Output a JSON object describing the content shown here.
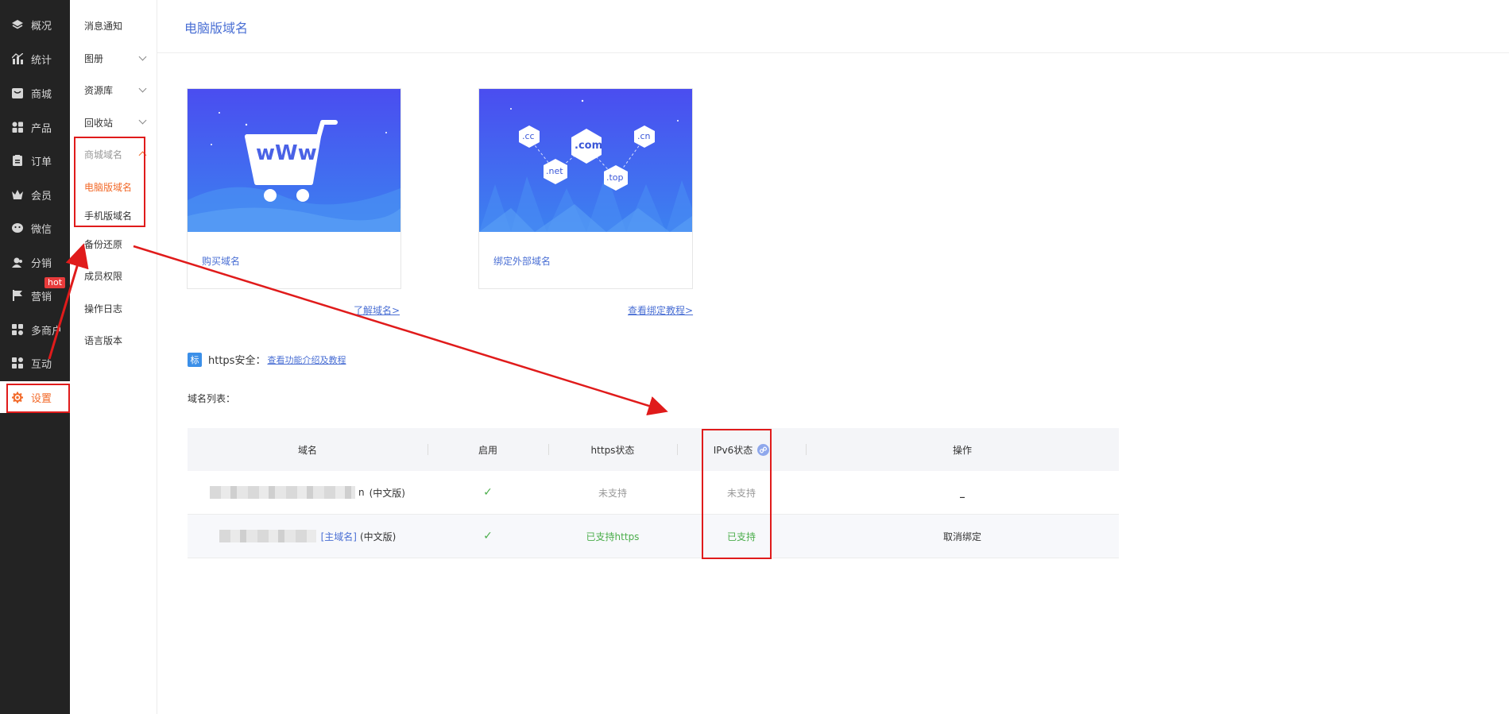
{
  "nav": {
    "items": [
      {
        "label": "概况",
        "icon": "layers-icon"
      },
      {
        "label": "统计",
        "icon": "chart-icon"
      },
      {
        "label": "商城",
        "icon": "shop-icon"
      },
      {
        "label": "产品",
        "icon": "grid-icon"
      },
      {
        "label": "订单",
        "icon": "clipboard-icon"
      },
      {
        "label": "会员",
        "icon": "crown-icon"
      },
      {
        "label": "微信",
        "icon": "wechat-icon"
      },
      {
        "label": "分销",
        "icon": "users-icon"
      },
      {
        "label": "营销",
        "icon": "flag-icon"
      },
      {
        "label": "多商户",
        "icon": "multi-shop-icon"
      },
      {
        "label": "互动",
        "icon": "interact-icon"
      },
      {
        "label": "设置",
        "icon": "gear-icon"
      }
    ],
    "hot_badge": "hot"
  },
  "submenu": {
    "items": [
      {
        "label": "消息通知"
      },
      {
        "label": "图册"
      },
      {
        "label": "资源库"
      },
      {
        "label": "回收站"
      },
      {
        "label": "商城域名"
      },
      {
        "label": "电脑版域名"
      },
      {
        "label": "手机版域名"
      },
      {
        "label": "备份还原"
      },
      {
        "label": "成员权限"
      },
      {
        "label": "操作日志"
      },
      {
        "label": "语言版本"
      }
    ]
  },
  "page": {
    "title": "电脑版域名"
  },
  "cards": [
    {
      "caption": "购买域名",
      "link": "了解域名>",
      "banner_text": "wWw"
    },
    {
      "caption": "绑定外部域名",
      "link": "查看绑定教程>",
      "bubbles": [
        ".cc",
        ".com",
        ".cn",
        ".net",
        ".top"
      ]
    }
  ],
  "https": {
    "badge": "标",
    "label": "https安全：",
    "link": "查看功能介绍及教程"
  },
  "list_label": "域名列表：",
  "table": {
    "headers": [
      "域名",
      "启用",
      "https状态",
      "IPv6状态",
      "操作"
    ],
    "rows": [
      {
        "domain_suffix": "n",
        "tag": "",
        "lang": "(中文版)",
        "enabled": "✓",
        "https": "未支持",
        "ipv6": "未支持",
        "action": "_"
      },
      {
        "domain_suffix": "",
        "tag": "[主域名]",
        "lang": "(中文版)",
        "enabled": "✓",
        "https": "已支持https",
        "ipv6": "已支持",
        "action": "取消绑定"
      }
    ]
  },
  "colors": {
    "accent": "#f26a2a",
    "link": "#4a6fd4",
    "success": "#4cae4c",
    "annotation": "#e01b1b",
    "nav_bg": "#232323"
  }
}
